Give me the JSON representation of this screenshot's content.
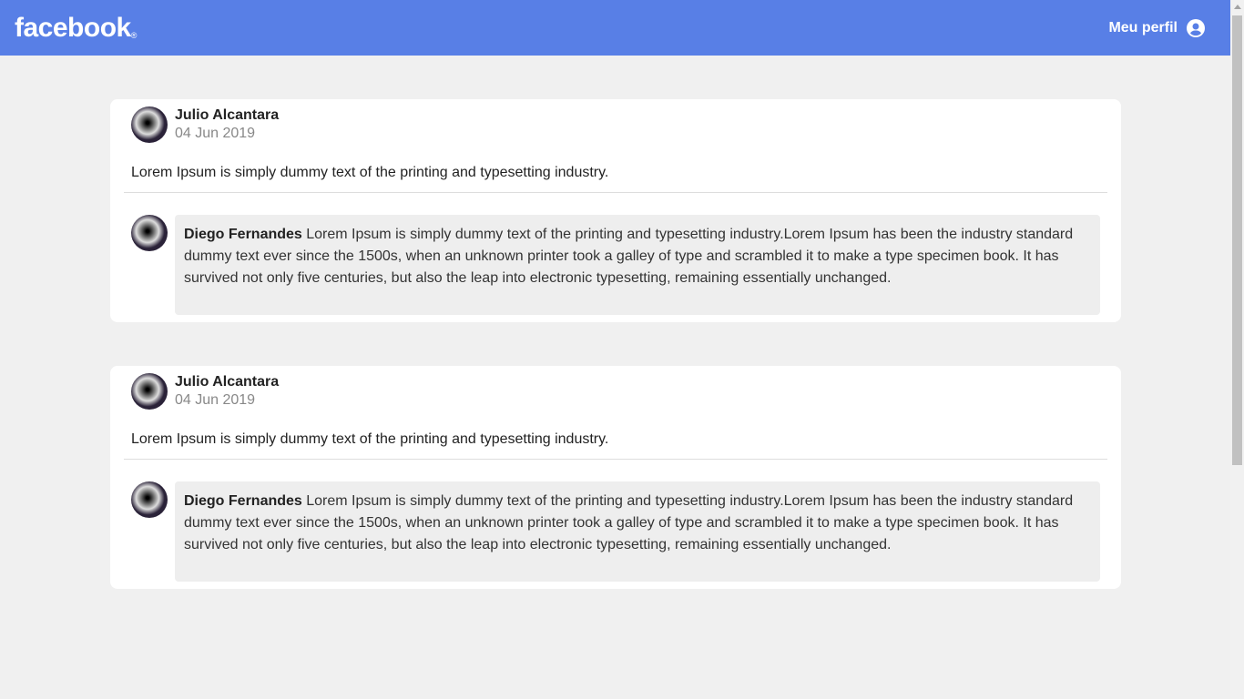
{
  "header": {
    "logo": "facebook",
    "logo_mark": "®",
    "profile_label": "Meu perfil"
  },
  "posts": [
    {
      "author": "Julio Alcantara",
      "date": "04 Jun 2019",
      "content": "Lorem Ipsum is simply dummy text of the printing and typesetting industry.",
      "comment": {
        "author": "Diego Fernandes",
        "text": " Lorem Ipsum is simply dummy text of the printing and typesetting industry.Lorem Ipsum has been the industry standard dummy text ever since the 1500s, when an unknown printer took a galley of type and scrambled it to make a type specimen book. It has survived not only five centuries, but also the leap into electronic typesetting, remaining essentially unchanged."
      }
    },
    {
      "author": "Julio Alcantara",
      "date": "04 Jun 2019",
      "content": "Lorem Ipsum is simply dummy text of the printing and typesetting industry.",
      "comment": {
        "author": "Diego Fernandes",
        "text": " Lorem Ipsum is simply dummy text of the printing and typesetting industry.Lorem Ipsum has been the industry standard dummy text ever since the 1500s, when an unknown printer took a galley of type and scrambled it to make a type specimen book. It has survived not only five centuries, but also the leap into electronic typesetting, remaining essentially unchanged."
      }
    }
  ]
}
